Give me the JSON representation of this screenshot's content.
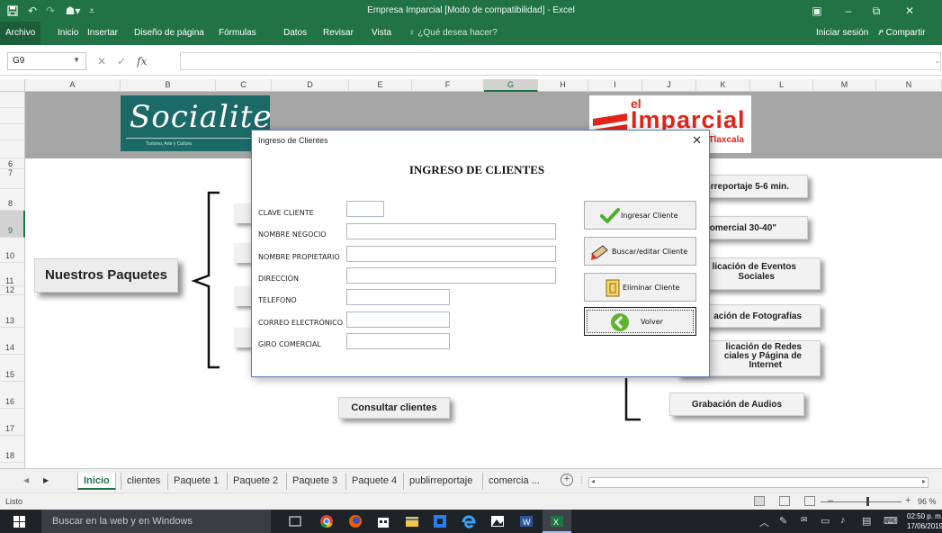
{
  "window": {
    "title": "Empresa Imparcial  [Modo de compatibilidad]  -  Excel"
  },
  "ribbon": {
    "tabs": [
      "Archivo",
      "Inicio",
      "Insertar",
      "Diseño de página",
      "Fórmulas",
      "Datos",
      "Revisar",
      "Vista"
    ],
    "tell_me": "¿Qué desea hacer?",
    "sign_in": "Iniciar sesión",
    "share": "Compartir"
  },
  "formula_bar": {
    "name_box": "G9",
    "fx": "fx",
    "value": ""
  },
  "grid": {
    "columns": [
      "A",
      "B",
      "C",
      "D",
      "E",
      "F",
      "G",
      "H",
      "I",
      "J",
      "K",
      "L",
      "M",
      "N"
    ],
    "selected_column": "G",
    "rows": [
      "",
      "",
      "",
      "",
      "6",
      "7",
      "8",
      "9",
      "10",
      "11",
      "12",
      "13",
      "14",
      "15",
      "16",
      "17",
      "18"
    ],
    "selected_row": "9"
  },
  "sheet": {
    "logo_left": {
      "name": "Socialite",
      "tagline": "Turismo, Arte y Cultura"
    },
    "logo_right": {
      "line1": "el",
      "line2": "Imparcial",
      "line3": "de Tlaxcala"
    },
    "nuestros_paquetes": "Nuestros Paquetes",
    "consultar_clientes": "Consultar clientes",
    "packages_right": [
      [
        "lirreportaje 5-6 min."
      ],
      [
        "omercial 30-40\""
      ],
      [
        "licación de Eventos",
        "Sociales"
      ],
      [
        "ación de Fotografías"
      ],
      [
        "licación de Redes",
        "ciales y Página de",
        "Internet"
      ],
      [
        "Grabación de Audios"
      ]
    ]
  },
  "dialog": {
    "caption": "Ingreso de Clientes",
    "heading": "INGRESO DE CLIENTES",
    "fields": [
      {
        "label": "CLAVE CLIENTE",
        "value": ""
      },
      {
        "label": "NOMBRE NEGOCIO",
        "value": ""
      },
      {
        "label": "NOMBRE PROPIETARIO",
        "value": ""
      },
      {
        "label": "DIRECCIÓN",
        "value": ""
      },
      {
        "label": "TELEFONO",
        "value": ""
      },
      {
        "label": "CORREO ELECTRÓNICO",
        "value": ""
      },
      {
        "label": "GIRO COMERCIAL",
        "value": ""
      }
    ],
    "buttons": {
      "ingresar": "Ingresar Cliente",
      "buscar": "Buscar/editar Cliente",
      "eliminar": "Eliminar Cliente",
      "volver": "Volver"
    }
  },
  "sheet_tabs": {
    "tabs": [
      "Inicio",
      "clientes",
      "Paquete 1",
      "Paquete 2",
      "Paquete 3",
      "Paquete 4",
      "publirreportaje",
      "comercia ..."
    ],
    "active": "Inicio"
  },
  "status_bar": {
    "status": "Listo",
    "zoom": "96 %"
  },
  "taskbar": {
    "search_placeholder": "Buscar en la web y en Windows",
    "time": "02:50 p. m.",
    "date": "17/06/2019"
  }
}
